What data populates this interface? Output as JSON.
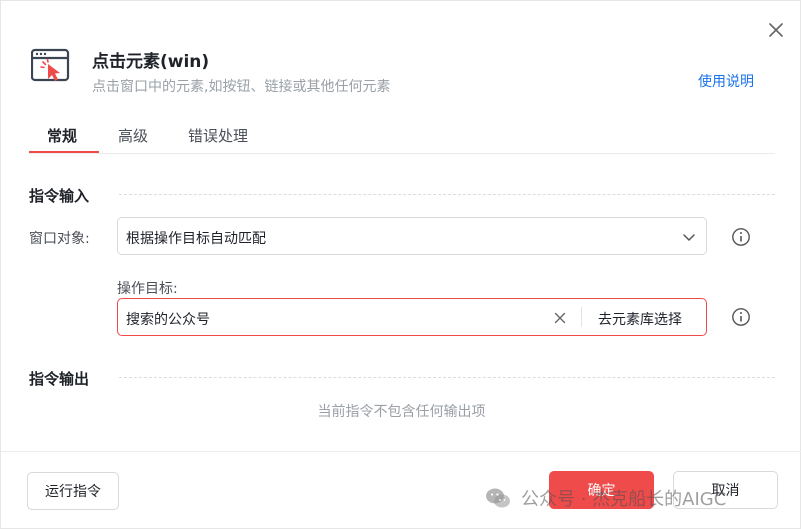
{
  "header": {
    "title": "点击元素(win)",
    "subtitle": "点击窗口中的元素,如按钮、链接或其他任何元素",
    "help_link": "使用说明"
  },
  "tabs": [
    {
      "label": "常规",
      "active": true
    },
    {
      "label": "高级",
      "active": false
    },
    {
      "label": "错误处理",
      "active": false
    }
  ],
  "input_section": {
    "title": "指令输入",
    "window_label": "窗口对象:",
    "window_value": "根据操作目标自动匹配",
    "target_label": "操作目标:",
    "target_value": "搜索的公众号",
    "target_pick_label": "去元素库选择"
  },
  "output_section": {
    "title": "指令输出",
    "empty_text": "当前指令不包含任何输出项"
  },
  "footer": {
    "run_label": "运行指令",
    "ok_label": "确定",
    "cancel_label": "取消"
  },
  "watermark": {
    "text": "公众号 · 杰克船长的AIGC"
  },
  "colors": {
    "accent": "#f04b4b",
    "link": "#1a73e8",
    "muted_text": "#9aa0a6"
  }
}
